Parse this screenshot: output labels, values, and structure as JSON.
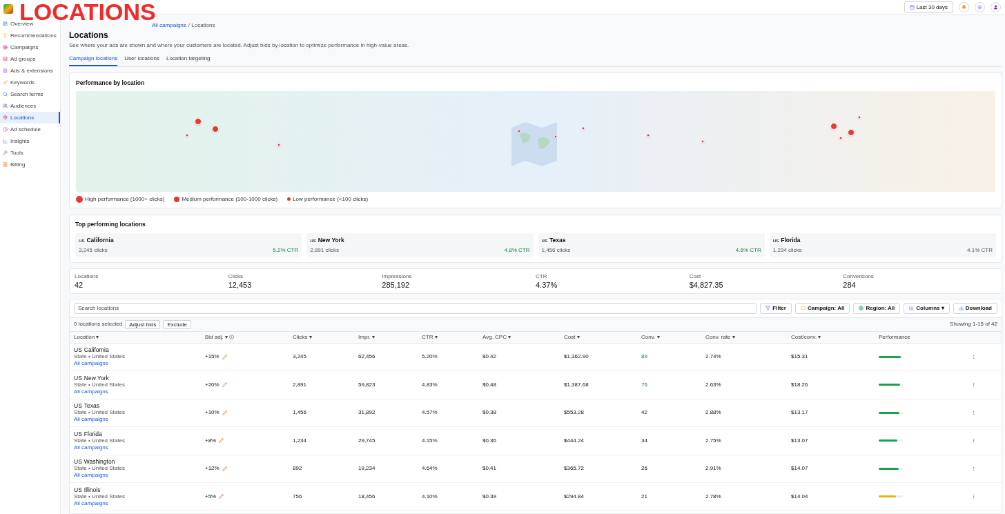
{
  "annotation": "LOCATIONS",
  "topbar": {
    "date_range": "Last 30 days"
  },
  "sidebar": {
    "items": [
      {
        "label": "Overview",
        "selected": false
      },
      {
        "label": "Recommendations",
        "selected": false
      },
      {
        "label": "Campaigns",
        "selected": false
      },
      {
        "label": "Ad groups",
        "selected": false
      },
      {
        "label": "Ads & extensions",
        "selected": false
      },
      {
        "label": "Keywords",
        "selected": false
      },
      {
        "label": "Search terms",
        "selected": false
      },
      {
        "label": "Audiences",
        "selected": false
      },
      {
        "label": "Locations",
        "selected": true
      },
      {
        "label": "Ad schedule",
        "selected": false
      },
      {
        "label": "Insights",
        "selected": false
      },
      {
        "label": "Tools",
        "selected": false
      },
      {
        "label": "Billing",
        "selected": false
      }
    ]
  },
  "breadcrumb": {
    "link": "All campaigns",
    "current": "/ Locations"
  },
  "title": "Locations",
  "description": "See where your ads are shown and where your customers are located. Adjust bids by location to optimize performance in high-value areas.",
  "tabs": [
    {
      "label": "Campaign locations",
      "selected": true
    },
    {
      "label": "User locations",
      "selected": false
    },
    {
      "label": "Location targeting",
      "selected": false
    }
  ],
  "map": {
    "title": "Performance by location",
    "markers": [
      {
        "kind": "high"
      },
      {
        "kind": "high"
      },
      {
        "kind": "low"
      },
      {
        "kind": "low"
      },
      {
        "kind": "low"
      },
      {
        "kind": "low"
      },
      {
        "kind": "low"
      },
      {
        "kind": "low"
      },
      {
        "kind": "low"
      },
      {
        "kind": "high"
      },
      {
        "kind": "high"
      },
      {
        "kind": "low"
      },
      {
        "kind": "low"
      }
    ],
    "legend": [
      {
        "kind": "high",
        "label": "High performance (1000+ clicks)"
      },
      {
        "kind": "medium",
        "label": "Medium performance (100-1000 clicks)"
      },
      {
        "kind": "low",
        "label": "Low performance (<100 clicks)"
      }
    ]
  },
  "top_locations": {
    "title": "Top performing locations",
    "items": [
      {
        "code": "us",
        "name": "California",
        "clicks": "3,245 clicks",
        "ctr": "5.2% CTR",
        "positive": true
      },
      {
        "code": "us",
        "name": "New York",
        "clicks": "2,891 clicks",
        "ctr": "4.8% CTR",
        "positive": true
      },
      {
        "code": "us",
        "name": "Texas",
        "clicks": "1,456 clicks",
        "ctr": "4.6% CTR",
        "positive": true
      },
      {
        "code": "us",
        "name": "Florida",
        "clicks": "1,234 clicks",
        "ctr": "4.1% CTR",
        "positive": false
      }
    ]
  },
  "stats": [
    {
      "label": "Locations",
      "value": "42"
    },
    {
      "label": "Clicks",
      "value": "12,453"
    },
    {
      "label": "Impressions",
      "value": "285,192"
    },
    {
      "label": "CTR",
      "value": "4.37%"
    },
    {
      "label": "Cost",
      "value": "$4,827.35"
    },
    {
      "label": "Conversions",
      "value": "284"
    }
  ],
  "toolbar": {
    "search_placeholder": "Search locations",
    "buttons": [
      {
        "kind": "filter",
        "label": "Filter"
      },
      {
        "kind": "campaign",
        "label": "Campaign: All"
      },
      {
        "kind": "region",
        "label": "Region: All"
      },
      {
        "kind": "columns",
        "label": "Columns ▾"
      },
      {
        "kind": "download",
        "label": "Download"
      }
    ],
    "selected_count": "0 locations selected",
    "actions": [
      "Adjust bids",
      "Exclude"
    ],
    "showing": "Showing 1-15 of 42"
  },
  "table": {
    "columns": [
      "Location ▾",
      "Bid adj. ▾",
      "Clicks ▾",
      "Impr. ▾",
      "CTR ▾",
      "Avg. CPC ▾",
      "Cost ▾",
      "Conv. ▾",
      "Conv. rate ▾",
      "Cost/conv. ▾",
      "Performance"
    ],
    "rows": [
      {
        "code": "US",
        "name": "California",
        "sub": "State • United States",
        "link": "All campaigns",
        "bid": "+15%",
        "clicks": "3,245",
        "impr": "62,456",
        "ctr": "5.20%",
        "cpc": "$0.42",
        "cost": "$1,362.90",
        "conv": "89",
        "conv_good": true,
        "conv_rate": "2.74%",
        "cost_conv": "$15.31",
        "level": 0.92,
        "color": "#16a34a"
      },
      {
        "code": "US",
        "name": "New York",
        "sub": "State • United States",
        "link": "All campaigns",
        "bid": "+20%",
        "clicks": "2,891",
        "impr": "59,823",
        "ctr": "4.83%",
        "cpc": "$0.48",
        "cost": "$1,387.68",
        "conv": "76",
        "conv_good": true,
        "conv_rate": "2.63%",
        "cost_conv": "$18.26",
        "level": 0.88,
        "color": "#16a34a"
      },
      {
        "code": "US",
        "name": "Texas",
        "sub": "State • United States",
        "link": "All campaigns",
        "bid": "+10%",
        "clicks": "1,456",
        "impr": "31,892",
        "ctr": "4.57%",
        "cpc": "$0.38",
        "cost": "$553.28",
        "conv": "42",
        "conv_good": false,
        "conv_rate": "2.88%",
        "cost_conv": "$13.17",
        "level": 0.85,
        "color": "#16a34a"
      },
      {
        "code": "US",
        "name": "Florida",
        "sub": "State • United States",
        "link": "All campaigns",
        "bid": "+8%",
        "clicks": "1,234",
        "impr": "29,745",
        "ctr": "4.15%",
        "cpc": "$0.36",
        "cost": "$444.24",
        "conv": "34",
        "conv_good": false,
        "conv_rate": "2.75%",
        "cost_conv": "$13.07",
        "level": 0.78,
        "color": "#16a34a"
      },
      {
        "code": "US",
        "name": "Washington",
        "sub": "State • United States",
        "link": "All campaigns",
        "bid": "+12%",
        "clicks": "892",
        "impr": "19,234",
        "ctr": "4.64%",
        "cpc": "$0.41",
        "cost": "$365.72",
        "conv": "26",
        "conv_good": false,
        "conv_rate": "2.91%",
        "cost_conv": "$14.07",
        "level": 0.82,
        "color": "#16a34a"
      },
      {
        "code": "US",
        "name": "Illinois",
        "sub": "State • United States",
        "link": "All campaigns",
        "bid": "+5%",
        "clicks": "756",
        "impr": "18,456",
        "ctr": "4.10%",
        "cpc": "$0.39",
        "cost": "$294.84",
        "conv": "21",
        "conv_good": false,
        "conv_rate": "2.78%",
        "cost_conv": "$14.04",
        "level": 0.7,
        "color": "#eab308"
      }
    ]
  }
}
